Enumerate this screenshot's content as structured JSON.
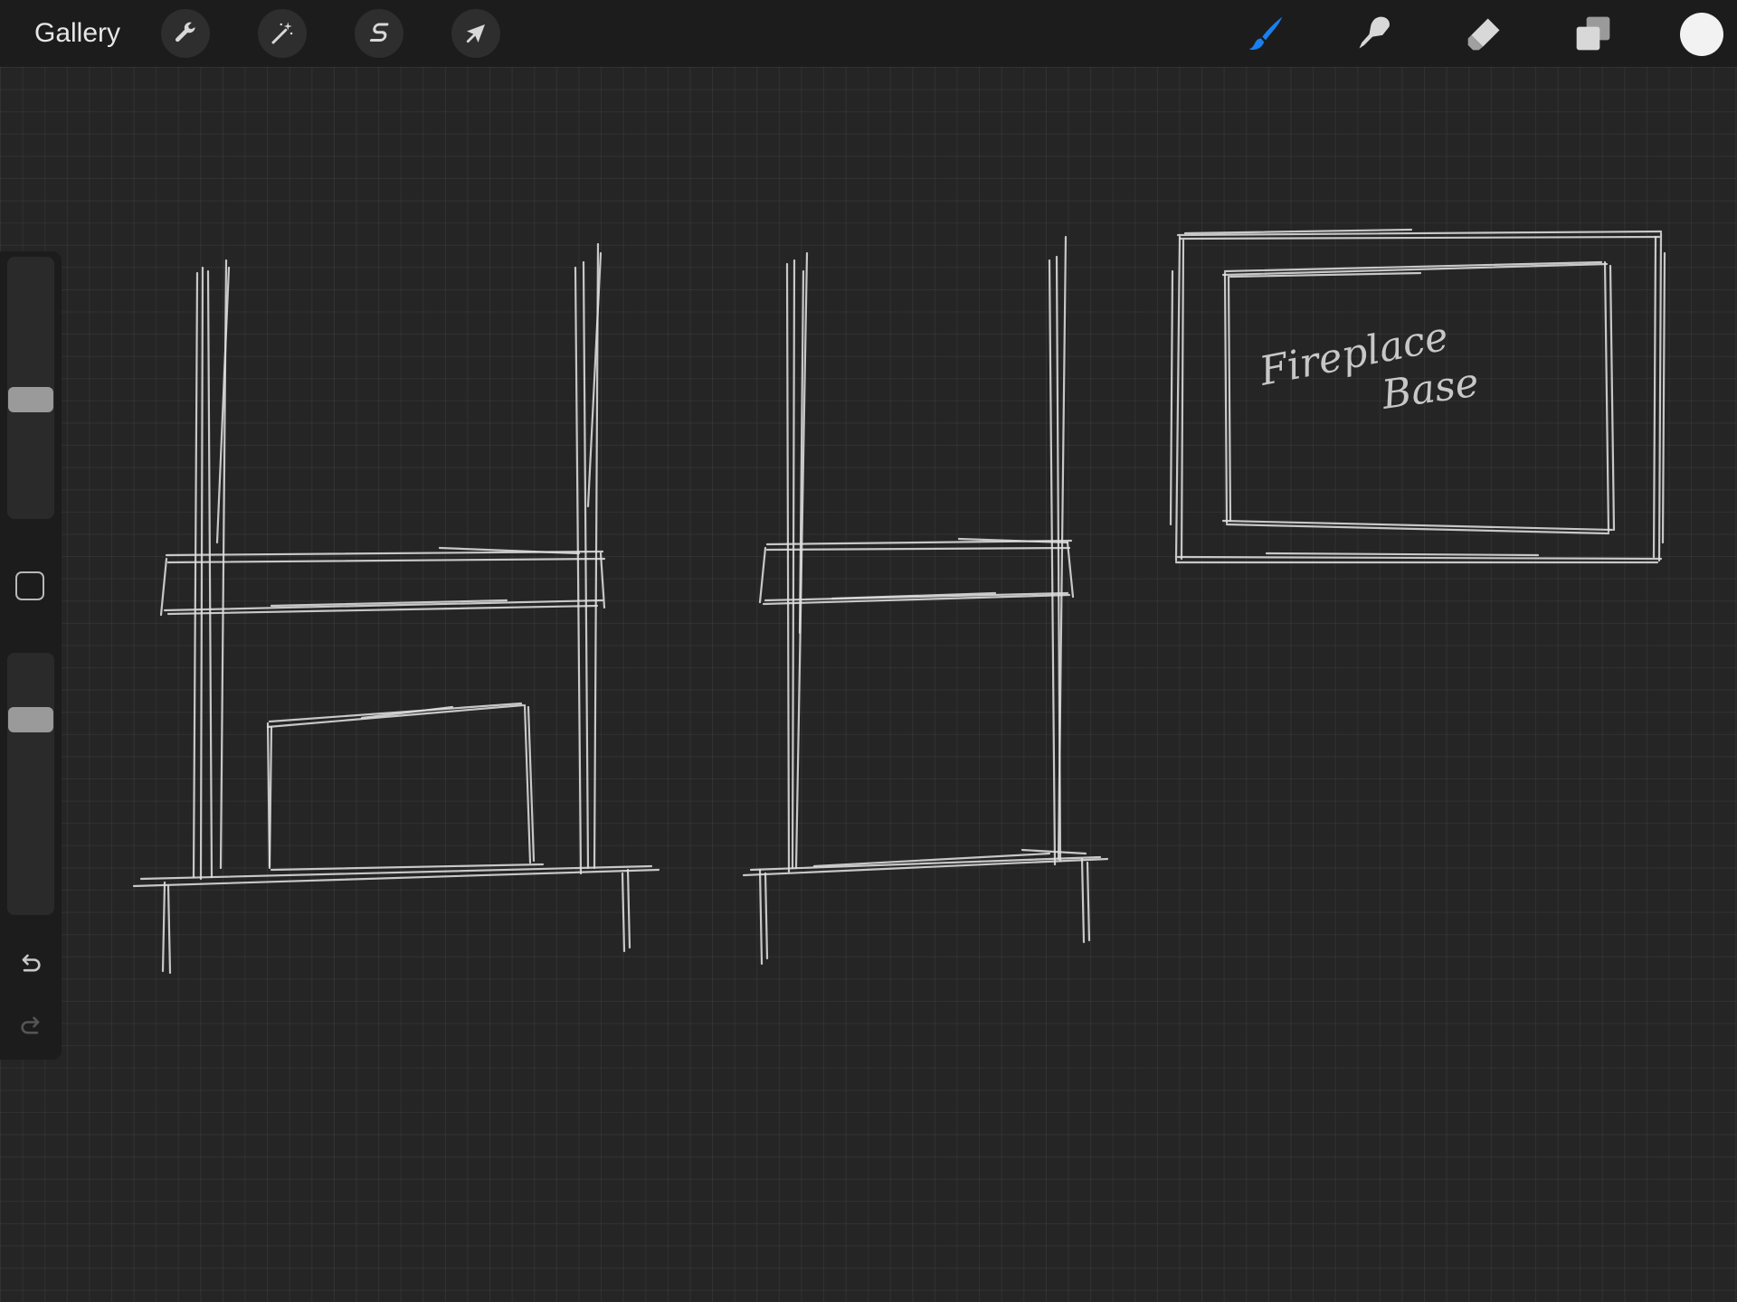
{
  "topbar": {
    "gallery_label": "Gallery",
    "left_tools": [
      {
        "name": "actions",
        "icon": "wrench-icon"
      },
      {
        "name": "adjustments",
        "icon": "magic-wand-icon"
      },
      {
        "name": "selection",
        "icon": "selection-s-icon"
      },
      {
        "name": "transform",
        "icon": "arrow-cursor-icon"
      }
    ],
    "right_tools": [
      {
        "name": "brush",
        "icon": "brush-icon",
        "active": true,
        "color": "#1a7ff0"
      },
      {
        "name": "smudge",
        "icon": "smudge-finger-icon",
        "active": false
      },
      {
        "name": "eraser",
        "icon": "eraser-icon",
        "active": false
      },
      {
        "name": "layers",
        "icon": "layers-icon",
        "active": false
      }
    ],
    "current_color": "#f2f2f2"
  },
  "sidebar": {
    "brush_size_level": 0.45,
    "opacity_level": 0.77,
    "modify_button_icon": "square-outline-icon",
    "undo_icon": "undo-arrow-icon",
    "redo_icon": "redo-arrow-icon"
  },
  "canvas": {
    "background_color": "#252525",
    "grid": true,
    "stroke_color": "#dedede",
    "sketch_note_lines": [
      "Fireplace",
      "Base"
    ]
  }
}
